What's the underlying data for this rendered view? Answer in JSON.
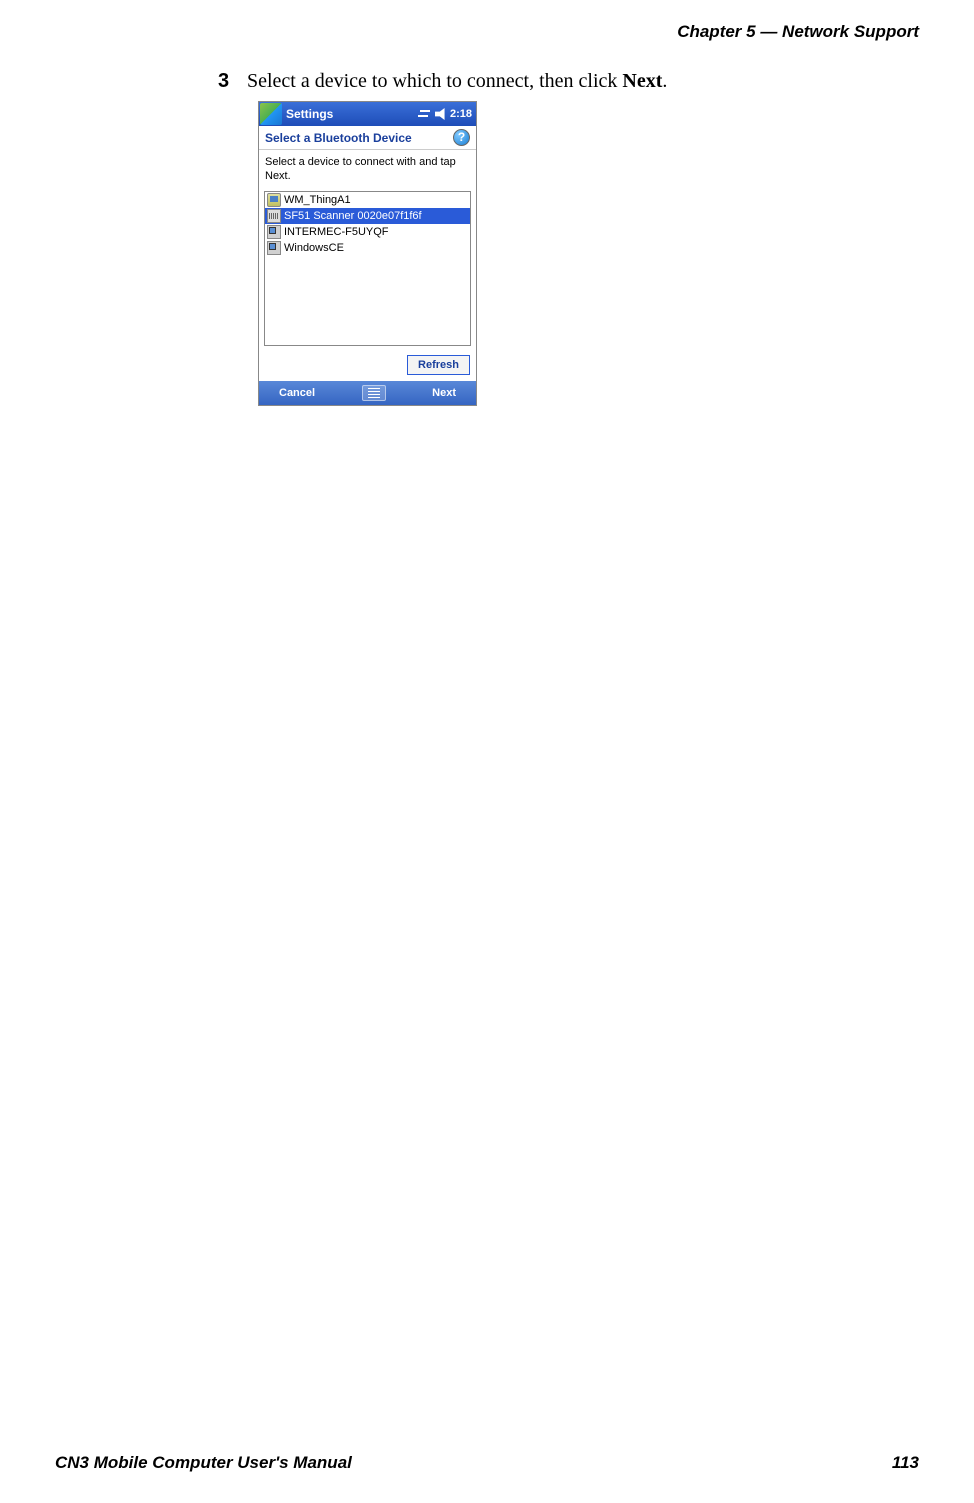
{
  "page": {
    "running_header": "Chapter 5 —  Network Support",
    "footer_left": "CN3 Mobile Computer User's Manual",
    "footer_right": "113"
  },
  "step": {
    "number": "3",
    "text_before": "Select a device to which to connect, then click ",
    "bold": "Next",
    "text_after": "."
  },
  "screenshot": {
    "titlebar": {
      "title": "Settings",
      "time": "2:18"
    },
    "subtitle": "Select a Bluetooth Device",
    "instruction": "Select a device to connect with and tap Next.",
    "devices": [
      {
        "label": "WM_ThingA1",
        "icon": "pda",
        "selected": false
      },
      {
        "label": "SF51 Scanner 0020e07f1f6f",
        "icon": "kb",
        "selected": true
      },
      {
        "label": "INTERMEC-F5UYQF",
        "icon": "pc",
        "selected": false
      },
      {
        "label": "WindowsCE",
        "icon": "pc",
        "selected": false
      }
    ],
    "refresh_label": "Refresh",
    "bottombar": {
      "cancel": "Cancel",
      "next": "Next"
    }
  }
}
